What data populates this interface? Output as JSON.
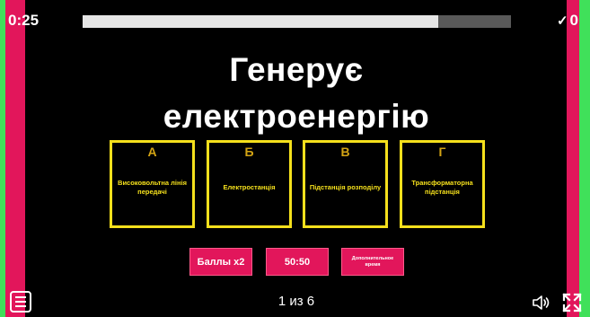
{
  "header": {
    "timer": "0:25",
    "progress_fraction": 0.83,
    "score_icon": "checkmark",
    "score": "0"
  },
  "question": {
    "text": "Генерує електроенергію"
  },
  "answers": [
    {
      "letter": "А",
      "text": "Високовольтна лінія передачі"
    },
    {
      "letter": "Б",
      "text": "Електростанція"
    },
    {
      "letter": "В",
      "text": "Підстанція розподілу"
    },
    {
      "letter": "Г",
      "text": "Трансформаторна підстанція"
    }
  ],
  "lifelines": {
    "double": "Баллы x2",
    "fifty": "50:50",
    "extra_time": "Дополнительное время"
  },
  "footer": {
    "menu_icon": "menu-icon",
    "page": "1 из 6",
    "sound_icon": "speaker-icon",
    "fullscreen_icon": "fullscreen-icon"
  },
  "colors": {
    "background": "#000000",
    "accent_pink": "#e2165b",
    "accent_green": "#40e05a",
    "answer_yellow": "#f5e01c"
  }
}
